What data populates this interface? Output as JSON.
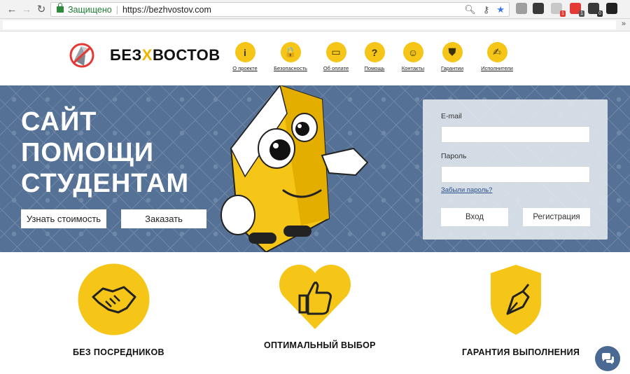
{
  "browser": {
    "secure_label": "Защищено",
    "url": "https://bezhvostov.com",
    "extensions": [
      {
        "name": "extension-1",
        "color": "#9e9e9e",
        "badge": ""
      },
      {
        "name": "extension-2",
        "color": "#3a3a3a",
        "badge": ""
      },
      {
        "name": "extension-3",
        "color": "#c8c8c8",
        "badge": "1",
        "badge_color": "#e53935"
      },
      {
        "name": "extension-4",
        "color": "#e53935",
        "badge": "1",
        "badge_color": "#555555"
      },
      {
        "name": "extension-5",
        "color": "#3a3a3a",
        "badge": "0",
        "badge_color": "#333333"
      },
      {
        "name": "extension-6",
        "color": "#222222",
        "badge": ""
      }
    ],
    "bookmarks_more": "»"
  },
  "site": {
    "logo_prefix": "БЕЗ",
    "logo_x": "Х",
    "logo_suffix": "ВОСТОВ",
    "menu": [
      {
        "icon": "info-icon",
        "glyph": "i",
        "label": "О проекте"
      },
      {
        "icon": "lock-icon",
        "glyph": "🔒",
        "label": "Безопасность"
      },
      {
        "icon": "wallet-icon",
        "glyph": "▭",
        "label": "Об оплате"
      },
      {
        "icon": "question-icon",
        "glyph": "?",
        "label": "Помощь"
      },
      {
        "icon": "contacts-icon",
        "glyph": "☺",
        "label": "Контакты"
      },
      {
        "icon": "shield-icon",
        "glyph": "⛊",
        "label": "Гарантии"
      },
      {
        "icon": "worker-icon",
        "glyph": "✍",
        "label": "Исполнители"
      }
    ]
  },
  "hero": {
    "title_lines": [
      "САЙТ",
      "ПОМОЩИ",
      "СТУДЕНТАМ"
    ],
    "btn_price": "Узнать стоимость",
    "btn_order": "Заказать"
  },
  "login": {
    "email_label": "E-mail",
    "password_label": "Пароль",
    "forgot": "Забыли пароль?",
    "login_btn": "Вход",
    "register_btn": "Регистрация"
  },
  "features": [
    {
      "label": "БЕЗ ПОСРЕДНИКОВ",
      "icon": "handshake-icon"
    },
    {
      "label": "ОПТИМАЛЬНЫЙ ВЫБОР",
      "icon": "thumbs-up-icon"
    },
    {
      "label": "ГАРАНТИЯ ВЫПОЛНЕНИЯ",
      "icon": "pen-nib-icon"
    }
  ],
  "colors": {
    "accent": "#f5c518",
    "hero_bg": "#557196"
  }
}
